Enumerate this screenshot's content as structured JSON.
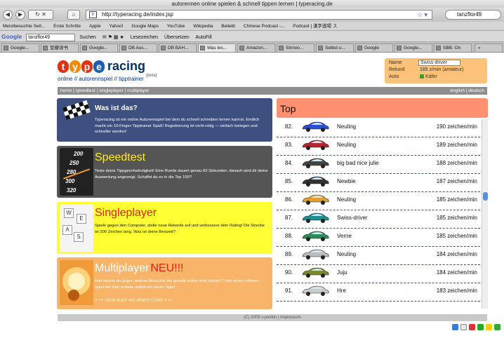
{
  "browser": {
    "title": "autorennen online spielen & schnell tippen lernen | typeracing.de",
    "url": "http://typeracing.de/index.jsp",
    "search_text": "tanzflor49",
    "bookmarks": [
      "Meistbesuchte Seit...",
      "Erste Schritte",
      "Apple",
      "Yahoo!",
      "Google Maps",
      "YouTube",
      "Wikipedia",
      "Beliebt",
      "Chinese Podcast -... ",
      "Podcast | 漢字道場 ス"
    ],
    "google_bar": {
      "logo": "Google",
      "query": "tanzflor49",
      "search_label": "Suchen",
      "items": [
        "Lesezeichen",
        "Übersetzen",
        "AutoFill"
      ]
    },
    "tabs": [
      "Google...",
      "豆瓣读书",
      "Google...",
      "DB Aus...",
      "DB BAH...",
      "Was les...",
      "Amazon...",
      "Sinnvo...",
      "Selbst u...",
      "Google",
      "Google...",
      "SBB: On"
    ],
    "tabs_more": "»"
  },
  "site": {
    "logo_letters": [
      "t",
      "y",
      "p",
      "e"
    ],
    "logo_colors": [
      "#dd3311",
      "#f08a00",
      "#dd3311",
      "#1b5fb0"
    ],
    "logo_word": "racing",
    "tagline": "online // autorennspiel // tipptrainer",
    "beta": "(beta)",
    "user": {
      "name_label": "Name",
      "name_value": "Swiss-driver",
      "record_label": "Rekord",
      "record_value": "185 z/min (amateur)",
      "car_label": "Auto",
      "car_value": "Käfer"
    },
    "menu": "home | speedtest | singleplayer | multiplayer",
    "lang": "english | deutsch"
  },
  "cards": [
    {
      "title": "Was ist das?",
      "text": "Typeracing ist ein online Autorennspiel bei dem du schnell schreiben lernen kannst. Endlich macht ein 10-Finger-Tipptrainer Spaß! Registrierung ist nicht nötig — einfach loslegen und schneller werden!",
      "icon": "checkered-flag-icon"
    },
    {
      "title": "Speedtest",
      "text": "Teste deine Tippgeschwindigkeit! Eine Runde dauert genau 60 Sekunden, danach wird dir deine Auswertung angezeigt. Schaffst du es in die Top 100?",
      "icon": "speedometer-icon",
      "gauge": [
        "200",
        "250",
        "280",
        "300",
        "320"
      ]
    },
    {
      "title": "Singleplayer",
      "text": "Spiele gegen den Computer, stelle neue Rekorde auf und verbessere dein Rating! Die Strecke ist 200 Zeichen lang. Was ist deine Bestzeit?",
      "icon": "keyboard-keys-icon",
      "keys": [
        "W",
        "E",
        "A",
        "S"
      ]
    },
    {
      "title": "Multiplayer",
      "title_new": "NEU!!!",
      "text": "Hier kannst du gegen andere Besucher die gerade online sind spielen! Trete einem offenen Spiel bei oder erstelle selbst ein neues Spiel.",
      "link": "+++ Jetzt auch mit einem Chat! +++",
      "icon": "explosion-icon"
    }
  ],
  "top": {
    "title": "Top",
    "rows": [
      {
        "rank": "82.",
        "name": "Neuling",
        "speed": "190 zeichen/min",
        "color": "#2a4fd0"
      },
      {
        "rank": "83.",
        "name": "Neuling",
        "speed": "189 zeichen/min",
        "color": "#b5262a"
      },
      {
        "rank": "84.",
        "name": "big bad nice julie",
        "speed": "188 zeichen/min",
        "color": "#444444"
      },
      {
        "rank": "85.",
        "name": "Newbie",
        "speed": "187 zeichen/min",
        "color": "#333333"
      },
      {
        "rank": "86.",
        "name": "Neuling",
        "speed": "185 zeichen/min",
        "color": "#e0a030"
      },
      {
        "rank": "87.",
        "name": "Swiss-driver",
        "speed": "185 zeichen/min",
        "color": "#1d8f8f"
      },
      {
        "rank": "88.",
        "name": "Verne",
        "speed": "185 zeichen/min",
        "color": "#2e8b57"
      },
      {
        "rank": "89.",
        "name": "Neuling",
        "speed": "184 zeichen/min",
        "color": "#bbbbbb"
      },
      {
        "rank": "90.",
        "name": "Juju",
        "speed": "184 zeichen/min",
        "color": "#7a8a2a"
      },
      {
        "rank": "91.",
        "name": "Hre",
        "speed": "183 zeichen/min",
        "color": "#cccccc"
      }
    ]
  },
  "footer": "(C) 2009 v.ponkin | Impressum"
}
